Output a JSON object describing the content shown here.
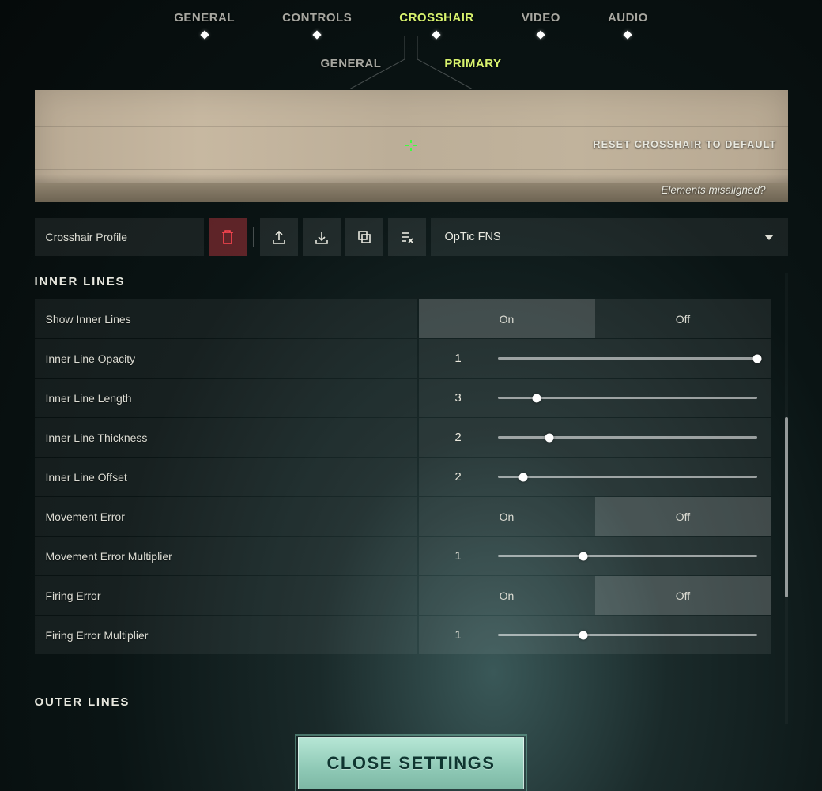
{
  "tabs_main": [
    {
      "label": "GENERAL",
      "active": false
    },
    {
      "label": "CONTROLS",
      "active": false
    },
    {
      "label": "CROSSHAIR",
      "active": true
    },
    {
      "label": "VIDEO",
      "active": false
    },
    {
      "label": "AUDIO",
      "active": false
    }
  ],
  "tabs_sub": [
    {
      "label": "GENERAL",
      "active": false
    },
    {
      "label": "PRIMARY",
      "active": true
    }
  ],
  "preview": {
    "reset_label": "RESET CROSSHAIR TO DEFAULT",
    "misaligned_label": "Elements misaligned?"
  },
  "profile": {
    "label": "Crosshair Profile",
    "selected": "OpTic FNS"
  },
  "toggle_options": {
    "on": "On",
    "off": "Off"
  },
  "sections": {
    "inner_title": "INNER LINES",
    "outer_title": "OUTER LINES"
  },
  "rows": [
    {
      "id": "show-inner",
      "label": "Show Inner Lines",
      "type": "toggle",
      "value": "On"
    },
    {
      "id": "inner-opacity",
      "label": "Inner Line Opacity",
      "type": "slider",
      "value": 1,
      "pct": 100
    },
    {
      "id": "inner-length",
      "label": "Inner Line Length",
      "type": "slider",
      "value": 3,
      "pct": 15
    },
    {
      "id": "inner-thick",
      "label": "Inner Line Thickness",
      "type": "slider",
      "value": 2,
      "pct": 20
    },
    {
      "id": "inner-offset",
      "label": "Inner Line Offset",
      "type": "slider",
      "value": 2,
      "pct": 10
    },
    {
      "id": "move-err",
      "label": "Movement Error",
      "type": "toggle",
      "value": "Off"
    },
    {
      "id": "move-err-mult",
      "label": "Movement Error Multiplier",
      "type": "slider",
      "value": 1,
      "pct": 33
    },
    {
      "id": "fire-err",
      "label": "Firing Error",
      "type": "toggle",
      "value": "Off"
    },
    {
      "id": "fire-err-mult",
      "label": "Firing Error Multiplier",
      "type": "slider",
      "value": 1,
      "pct": 33
    }
  ],
  "scrollbar": {
    "thumb_top_pct": 32,
    "thumb_height_pct": 40
  },
  "close_label": "CLOSE SETTINGS"
}
